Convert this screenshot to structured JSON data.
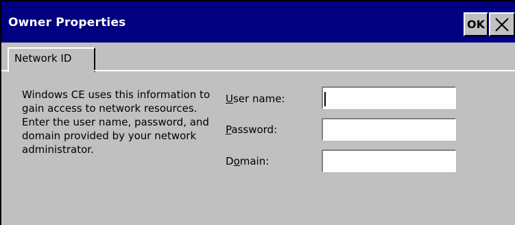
{
  "window": {
    "title": "Owner Properties",
    "ok_label": "OK"
  },
  "tabs": [
    {
      "label": "Network ID",
      "selected": true
    }
  ],
  "description": "Windows CE uses this information to gain access to network resources. Enter the user name, password, and domain provided by your network administrator.",
  "fields": {
    "username": {
      "label_underlined": "U",
      "label_rest": "ser name:",
      "value": ""
    },
    "password": {
      "label_underlined": "P",
      "label_rest": "assword:",
      "value": ""
    },
    "domain": {
      "label_pre": "D",
      "label_underlined": "o",
      "label_rest": "main:",
      "value": ""
    }
  },
  "colors": {
    "titlebar": "#000080",
    "face": "#c0c0c0"
  },
  "icons": {
    "close": "close-icon"
  }
}
